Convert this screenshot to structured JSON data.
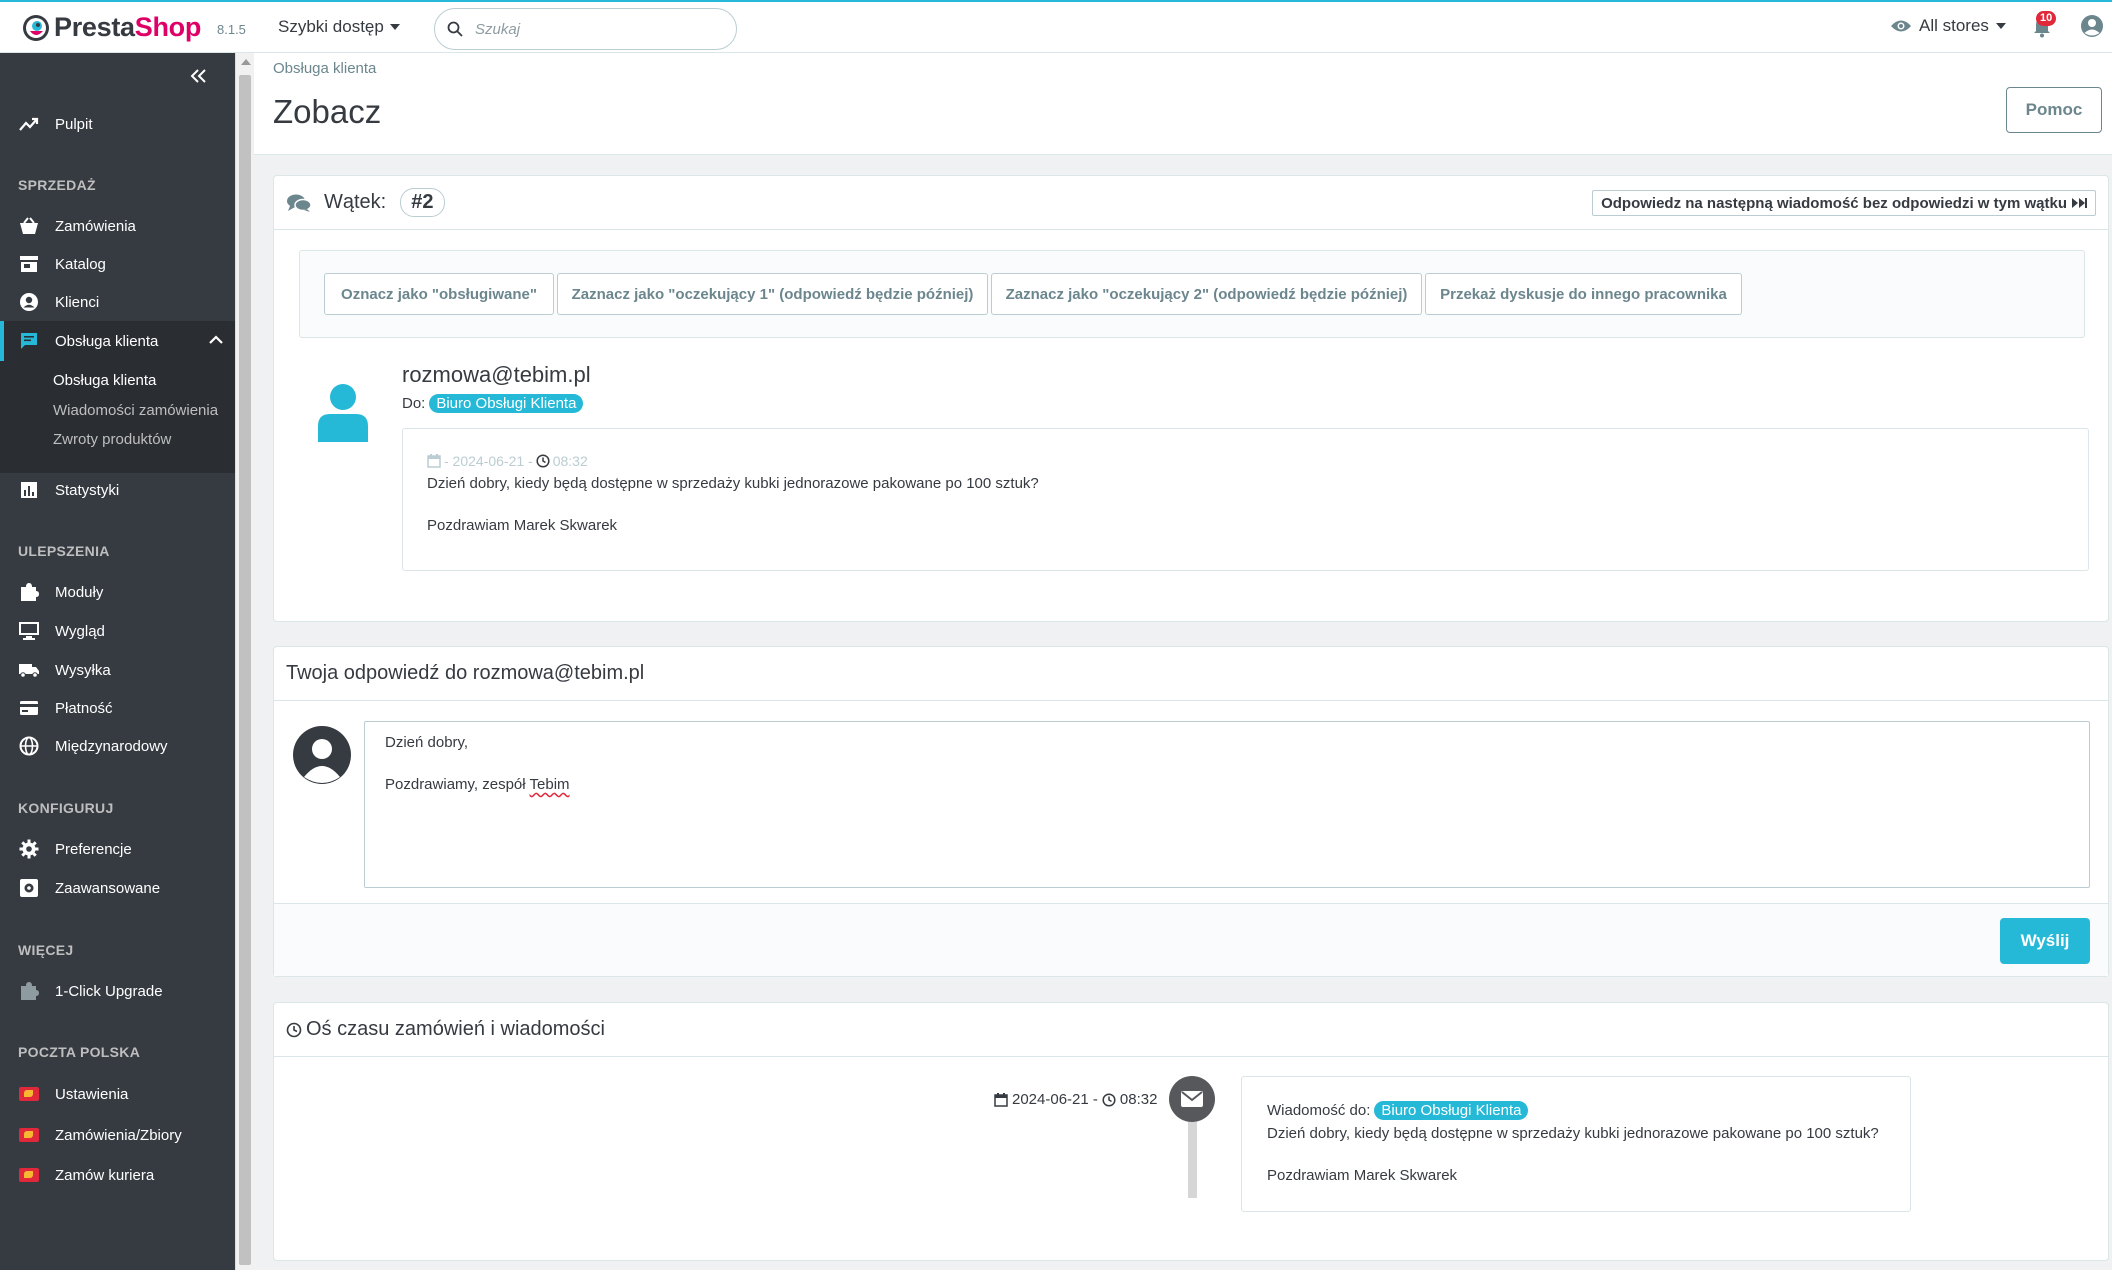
{
  "header": {
    "logo_presta": "Presta",
    "logo_shop": "Shop",
    "version": "8.1.5",
    "quick_access": "Szybki dostęp",
    "search_placeholder": "Szukaj",
    "stores": "All stores",
    "notifications_count": "10"
  },
  "sidebar": {
    "dashboard": "Pulpit",
    "section_sell": "SPRZEDAŻ",
    "orders": "Zamówienia",
    "catalog": "Katalog",
    "customers": "Klienci",
    "customer_service": "Obsługa klienta",
    "sub_items": [
      "Obsługa klienta",
      "Wiadomości zamówienia",
      "Zwroty produktów"
    ],
    "stats": "Statystyki",
    "section_improve": "ULEPSZENIA",
    "modules": "Moduły",
    "design": "Wygląd",
    "shipping": "Wysyłka",
    "payment": "Płatność",
    "international": "Międzynarodowy",
    "section_configure": "KONFIGURUJ",
    "preferences": "Preferencje",
    "advanced": "Zaawansowane",
    "section_more": "WIĘCEJ",
    "upgrade": "1-Click Upgrade",
    "section_pp": "POCZTA POLSKA",
    "pp_settings": "Ustawienia",
    "pp_orders": "Zamówienia/Zbiory",
    "pp_courier": "Zamów kuriera"
  },
  "page": {
    "breadcrumb": "Obsługa klienta",
    "title": "Zobacz",
    "help_button": "Pomoc"
  },
  "thread": {
    "label": "Wątek:",
    "number": "#2",
    "next_unanswered": "Odpowiedz na następną wiadomość bez odpowiedzi w tym wątku",
    "actions": [
      "Oznacz jako \"obsługiwane\"",
      "Zaznacz jako \"oczekujący 1\" (odpowiedź będzie później)",
      "Zaznacz jako \"oczekujący 2\" (odpowiedź będzie później)",
      "Przekaż dyskusje do innego pracownika"
    ],
    "sender_email": "rozmowa@tebim.pl",
    "to_label": "Do:",
    "to_value": "Biuro Obsługi Klienta",
    "message_date": "- 2024-06-21 -",
    "message_time": "08:32",
    "message_line1": "Dzień dobry, kiedy będą dostępne w sprzedaży kubki jednorazowe pakowane po 100 sztuk?",
    "message_line2": "Pozdrawiam Marek Skwarek"
  },
  "reply": {
    "heading": "Twoja odpowiedź do rozmowa@tebim.pl",
    "line1": "Dzień dobry,",
    "line2_prefix": "Pozdrawiamy, zespół",
    "line2_name": "Tebim",
    "send_button": "Wyślij"
  },
  "timeline": {
    "heading": "Oś czasu zamówień i wiadomości",
    "date": "2024-06-21 -",
    "time": "08:32",
    "message_to_label": "Wiadomość do:",
    "message_to_value": "Biuro Obsługi Klienta",
    "line1": "Dzień dobry, kiedy będą dostępne w sprzedaży kubki jednorazowe pakowane po 100 sztuk?",
    "line2": "Pozdrawiam Marek Skwarek"
  },
  "colors": {
    "accent": "#25b9d7",
    "sidebar": "#363a41",
    "brand_pink": "#df0067"
  }
}
